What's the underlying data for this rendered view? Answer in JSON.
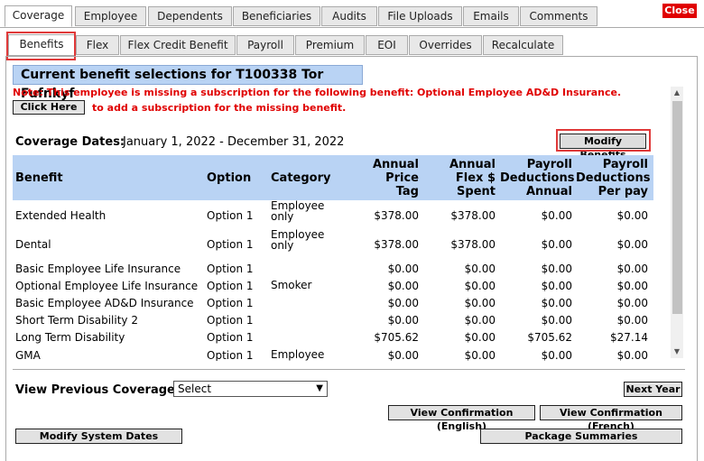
{
  "top_tabs": [
    "Coverage",
    "Employee",
    "Dependents",
    "Beneficiaries",
    "Audits",
    "File Uploads",
    "Emails",
    "Comments"
  ],
  "close_label": "Close",
  "sub_tabs": [
    "Benefits",
    "Flex",
    "Flex Credit Benefit",
    "Payroll",
    "Premium",
    "EOI",
    "Overrides",
    "Recalculate"
  ],
  "header": {
    "title": "Current benefit selections for T100338 Tor Fufnkyf",
    "note": "Note: This employee is missing a subscription for the following benefit: Optional Employee AD&D Insurance.",
    "click_here": "Click Here",
    "add_sub": "to add a subscription for the missing benefit."
  },
  "coverage": {
    "label": "Coverage Dates:",
    "dates": "January 1, 2022 - December 31, 2022",
    "modify_button": "Modify Benefits"
  },
  "table": {
    "columns": [
      "Benefit",
      "Option",
      "Category",
      "Annual Price Tag",
      "Annual Flex $ Spent",
      "Payroll Deductions Annual",
      "Payroll Deductions Per pay"
    ],
    "rows": [
      {
        "benefit": "Extended Health",
        "option": "Option 1",
        "category": "Employee only",
        "price": "$378.00",
        "flex": "$378.00",
        "annual": "$0.00",
        "perpay": "$0.00"
      },
      {
        "benefit": "Dental",
        "option": "Option 1",
        "category": "Employee only",
        "price": "$378.00",
        "flex": "$378.00",
        "annual": "$0.00",
        "perpay": "$0.00"
      },
      {
        "benefit": "Basic Employee Life Insurance",
        "option": "Option 1",
        "category": "",
        "price": "$0.00",
        "flex": "$0.00",
        "annual": "$0.00",
        "perpay": "$0.00"
      },
      {
        "benefit": "Optional Employee Life Insurance",
        "option": "Option 1",
        "category": "Smoker",
        "price": "$0.00",
        "flex": "$0.00",
        "annual": "$0.00",
        "perpay": "$0.00"
      },
      {
        "benefit": "Basic Employee AD&D Insurance",
        "option": "Option 1",
        "category": "",
        "price": "$0.00",
        "flex": "$0.00",
        "annual": "$0.00",
        "perpay": "$0.00"
      },
      {
        "benefit": "Short Term Disability 2",
        "option": "Option 1",
        "category": "",
        "price": "$0.00",
        "flex": "$0.00",
        "annual": "$0.00",
        "perpay": "$0.00"
      },
      {
        "benefit": "Long Term Disability",
        "option": "Option 1",
        "category": "",
        "price": "$705.62",
        "flex": "$0.00",
        "annual": "$705.62",
        "perpay": "$27.14"
      },
      {
        "benefit": "GMA",
        "option": "Option 1",
        "category": "Employee",
        "price": "$0.00",
        "flex": "$0.00",
        "annual": "$0.00",
        "perpay": "$0.00"
      }
    ]
  },
  "footer": {
    "view_prev_label": "View Previous Coverage:",
    "select_value": "Select",
    "next_year": "Next Year",
    "conf_en": "View Confirmation (English)",
    "conf_fr": "View Confirmation (French)",
    "modify_dates": "Modify System Dates",
    "package_summaries": "Package Summaries"
  },
  "colors": {
    "accent": "#b9d3f4",
    "alert": "#e00000",
    "highlight": "#e03a3a"
  }
}
